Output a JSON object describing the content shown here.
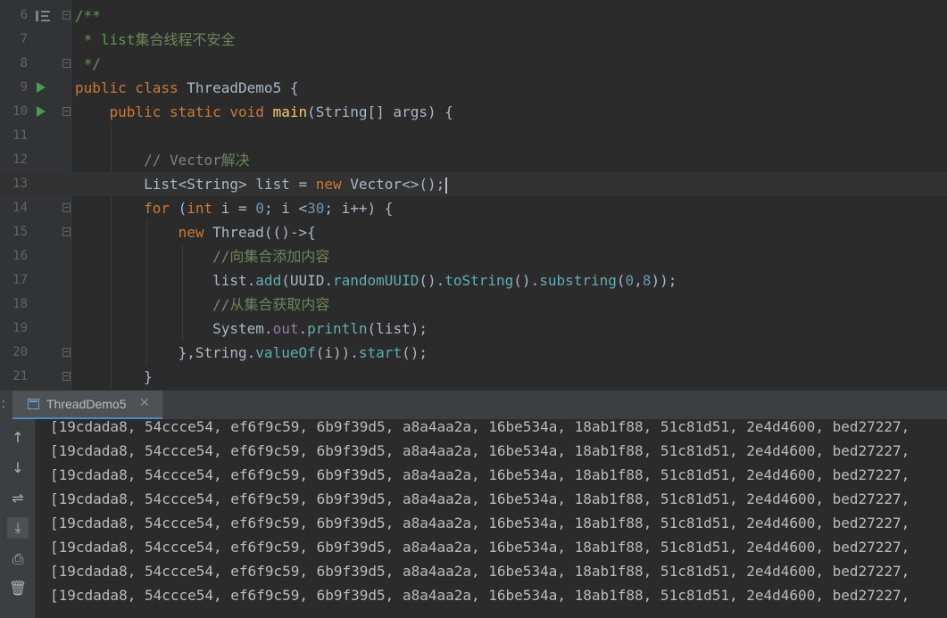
{
  "editor": {
    "lines": {
      "l6": {
        "num": "6",
        "t1": "/**"
      },
      "l7": {
        "num": "7",
        "t1": " * list",
        "t2": "集合线程不安全"
      },
      "l8": {
        "num": "8",
        "t1": " */"
      },
      "l9": {
        "num": "9",
        "t1": "public class ",
        "t2": "ThreadDemo5",
        "t3": " {"
      },
      "l10": {
        "num": "10",
        "t1": "    public static void ",
        "t2": "main",
        "t3": "(",
        "t4": "String",
        "t5": "[] args) {"
      },
      "l11": {
        "num": "11"
      },
      "l12": {
        "num": "12",
        "t1": "        // Vector",
        "t2": "解决"
      },
      "l13": {
        "num": "13",
        "t1": "        List<",
        "t2": "String",
        "t3": "> list = ",
        "t4": "new ",
        "t5": "Vector",
        "t6": "<>();"
      },
      "l14": {
        "num": "14",
        "t1": "        for ",
        "t2": "(",
        "t3": "int ",
        "t4": "i = ",
        "t5": "0",
        "t6": "; i <",
        "t7": "30",
        "t8": "; i++) {"
      },
      "l15": {
        "num": "15",
        "t1": "            new ",
        "t2": "Thread",
        "t3": "(()->{"
      },
      "l16": {
        "num": "16",
        "t1": "                //",
        "t2": "向集合添加内容"
      },
      "l17": {
        "num": "17",
        "t1": "                list.",
        "t2": "add",
        "t3": "(UUID.",
        "t4": "randomUUID",
        "t5": "().",
        "t6": "toString",
        "t7": "().",
        "t8": "substring",
        "t9": "(",
        "t10": "0",
        "t11": ",",
        "t12": "8",
        "t13": "));"
      },
      "l18": {
        "num": "18",
        "t1": "                //",
        "t2": "从集合获取内容"
      },
      "l19": {
        "num": "19",
        "t1": "                System.",
        "t2": "out",
        "t3": ".",
        "t4": "println",
        "t5": "(list);"
      },
      "l20": {
        "num": "20",
        "t1": "            },",
        "t2": "String",
        "t3": ".",
        "t4": "valueOf",
        "t5": "(i)).",
        "t6": "start",
        "t7": "();"
      },
      "l21": {
        "num": "21",
        "t1": "        }"
      }
    }
  },
  "run_panel": {
    "colon": ":",
    "tab_label": "ThreadDemo5",
    "tab_close": "✕",
    "tools": {
      "up": "↑",
      "down": "↓",
      "wrap": "⇌",
      "scroll_end": "⤓",
      "print": "⎙",
      "trash": "🗑"
    },
    "output": [
      "[19cdada8, 54ccce54, ef6f9c59, 6b9f39d5, a8a4aa2a, 16be534a, 18ab1f88, 51c81d51, 2e4d4600, bed27227,",
      "[19cdada8, 54ccce54, ef6f9c59, 6b9f39d5, a8a4aa2a, 16be534a, 18ab1f88, 51c81d51, 2e4d4600, bed27227,",
      "[19cdada8, 54ccce54, ef6f9c59, 6b9f39d5, a8a4aa2a, 16be534a, 18ab1f88, 51c81d51, 2e4d4600, bed27227,",
      "[19cdada8, 54ccce54, ef6f9c59, 6b9f39d5, a8a4aa2a, 16be534a, 18ab1f88, 51c81d51, 2e4d4600, bed27227,",
      "[19cdada8, 54ccce54, ef6f9c59, 6b9f39d5, a8a4aa2a, 16be534a, 18ab1f88, 51c81d51, 2e4d4600, bed27227,",
      "[19cdada8, 54ccce54, ef6f9c59, 6b9f39d5, a8a4aa2a, 16be534a, 18ab1f88, 51c81d51, 2e4d4600, bed27227,",
      "[19cdada8, 54ccce54, ef6f9c59, 6b9f39d5, a8a4aa2a, 16be534a, 18ab1f88, 51c81d51, 2e4d4600, bed27227,",
      "[19cdada8, 54ccce54, ef6f9c59, 6b9f39d5, a8a4aa2a, 16be534a, 18ab1f88, 51c81d51, 2e4d4600, bed27227,"
    ]
  },
  "colors": {
    "editor_bg": "#2b2b2b",
    "keyword": "#cc7832",
    "doc_comment": "#629755",
    "line_comment": "#808080",
    "method_decl": "#ffc66d",
    "number": "#6897bb",
    "run_icon": "#499c54",
    "tab_accent": "#4a88c7"
  }
}
